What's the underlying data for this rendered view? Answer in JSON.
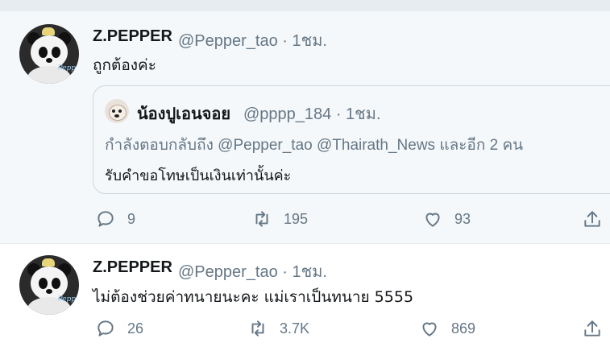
{
  "tweets": [
    {
      "display_name": "Z.PEPPER",
      "meta": "@Pepper_tao · 1ชม.",
      "text": "ถูกต้องค่ะ",
      "quote": {
        "display_name": "น้องปูเอนจอย",
        "meta": "@pppp_184 · 1ชม.",
        "replying": "กำลังตอบกลับถึง @Pepper_tao @Thairath_News  และอีก 2 คน",
        "text": "รับคำขอโทษเป็นเงินเท่านั้นค่ะ"
      },
      "actions": {
        "reply_count": "9",
        "retweet_count": "195",
        "like_count": "93"
      }
    },
    {
      "display_name": "Z.PEPPER",
      "meta": "@Pepper_tao · 1ชม.",
      "text": "ไม่ต้องช่วยค่าทนายนะคะ แม่เราเป็นทนาย 5555",
      "actions": {
        "reply_count": "26",
        "retweet_count": "3.7K",
        "like_count": "869"
      }
    }
  ],
  "icons": {
    "reply": "reply-icon",
    "retweet": "retweet-icon",
    "like": "heart-icon",
    "share": "share-icon"
  },
  "colors": {
    "muted_text": "#657786",
    "name_text": "#14171a",
    "tweet_bg_highlight": "#f5f8fa",
    "divider": "#e6ecf0"
  }
}
